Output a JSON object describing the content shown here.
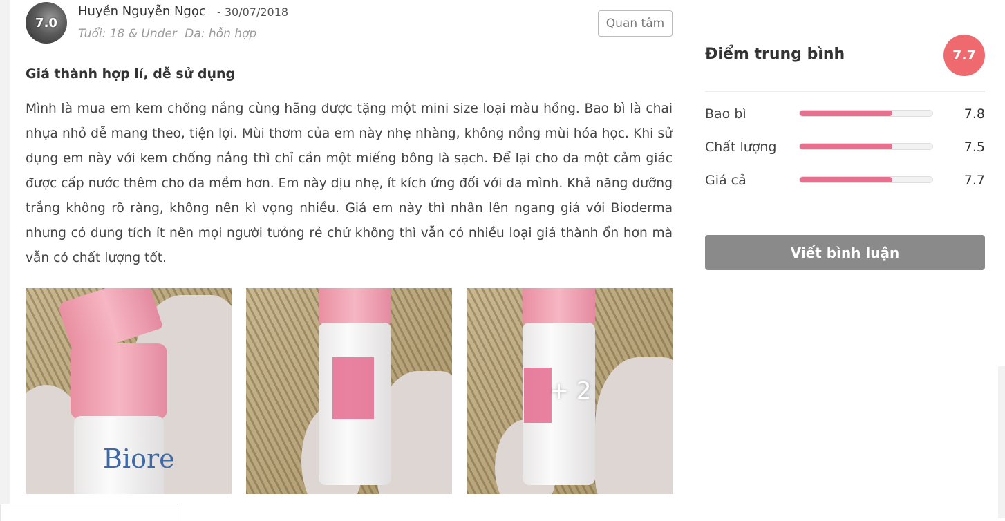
{
  "review": {
    "avatar_score": "7.0",
    "author": "Huyền Nguyễn Ngọc",
    "date": "- 30/07/2018",
    "age": "Tuổi: 18 & Under",
    "skin": "Da: hỗn hợp",
    "follow_label": "Quan tâm",
    "title": "Giá thành hợp lí, dễ sử dụng",
    "body": "Mình là mua em kem chống nắng cùng hãng được tặng một mini size loại màu hồng. Bao bì là chai nhựa nhỏ dễ mang theo, tiện lợi. Mùi thơm của em này nhẹ nhàng, không nồng mùi hóa học. Khi sử dụng em này với kem chống nắng thì chỉ cần một miếng bông là sạch. Để lại cho da một cảm giác được cấp nước thêm cho da mềm hơn. Em này dịu nhẹ, ít kích ứng đối với da mình. Khả năng dưỡng trắng không rõ ràng, không nên kì vọng nhiều. Giá em này thì nhân lên ngang giá với Bioderma nhưng có dung tích ít nên mọi người tưởng rẻ chứ không thì vẫn có nhiều loại giá thành ổn hơn mà vẫn có chất lượng tốt.",
    "photos": {
      "brand_text": "Biore",
      "more_count": "+ 2"
    }
  },
  "sidebar": {
    "avg_title": "Điểm trung bình",
    "avg_score": "7.7",
    "criteria": [
      {
        "label": "Bao bì",
        "value": "7.8",
        "fraction": 0.7
      },
      {
        "label": "Chất lượng",
        "value": "7.5",
        "fraction": 0.7
      },
      {
        "label": "Giá cả",
        "value": "7.7",
        "fraction": 0.7
      }
    ],
    "write_label": "Viết bình luận"
  },
  "colors": {
    "accent_pink": "#e8708f",
    "avg_circle": "#ee6a6f",
    "button_gray": "#8a8a8a"
  }
}
